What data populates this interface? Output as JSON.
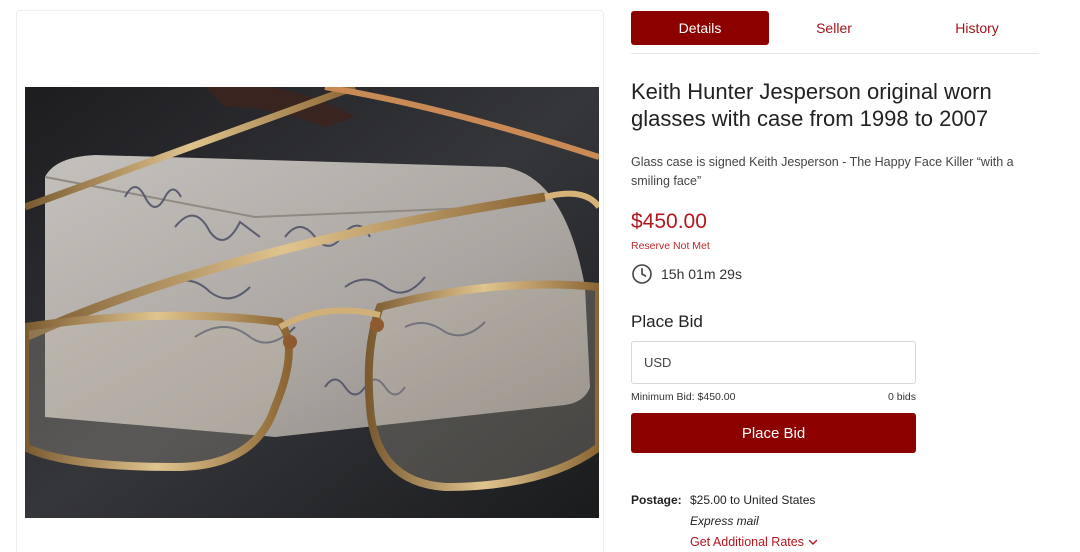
{
  "tabs": {
    "details": "Details",
    "seller": "Seller",
    "history": "History"
  },
  "listing": {
    "title": "Keith Hunter Jesperson original worn glasses with case from 1998 to 2007",
    "description": "Glass case is signed Keith Jesperson - The Happy Face Killer “with a smiling face”",
    "price": "$450.00",
    "reserve_status": "Reserve Not Met",
    "time_left": "15h 01m 29s"
  },
  "bid": {
    "heading": "Place Bid",
    "currency_placeholder": "USD",
    "minimum_bid": "Minimum Bid: $450.00",
    "bid_count": "0 bids",
    "button_label": "Place Bid"
  },
  "shipping": {
    "label": "Postage:",
    "value": "$25.00 to United States",
    "method": "Express mail",
    "rates_link": "Get Additional Rates"
  },
  "icons": {
    "timer": "clock-icon",
    "rates": "chevron-down-icon"
  },
  "colors": {
    "accent": "#8d0000",
    "price": "#b3161f"
  }
}
